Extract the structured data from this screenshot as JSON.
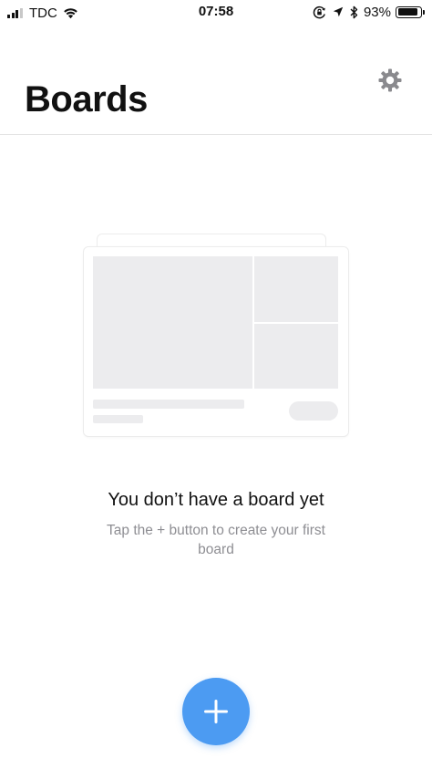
{
  "status_bar": {
    "carrier": "TDC",
    "time": "07:58",
    "battery_percent": "93%",
    "battery_level": 0.93,
    "signal_bars_filled": 3,
    "signal_bars_total": 4,
    "icons": [
      "wifi-icon",
      "orientation-lock-icon",
      "location-arrow-icon",
      "bluetooth-icon",
      "battery-icon"
    ]
  },
  "header": {
    "title": "Boards",
    "settings_icon": "gear-icon"
  },
  "empty_state": {
    "title": "You don’t have a board yet",
    "subtitle": "Tap the + button to create your first board"
  },
  "fab": {
    "icon": "plus-icon",
    "color": "#4c9bf2"
  },
  "colors": {
    "text": "#111111",
    "muted": "#8e8e93",
    "placeholder": "#ececee",
    "divider": "#e2e2e2",
    "gear": "#8a8a8e"
  }
}
